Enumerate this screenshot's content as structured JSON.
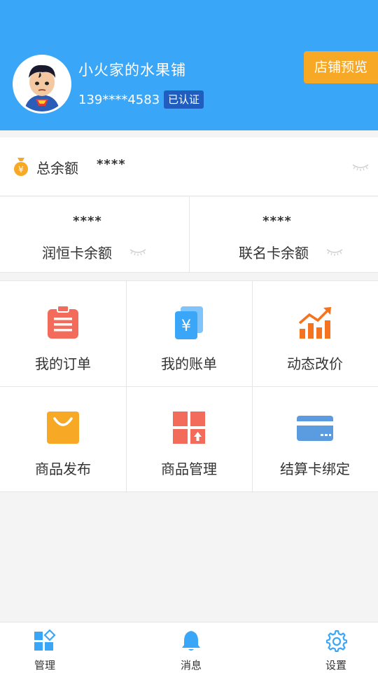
{
  "header": {
    "store_name": "小火家的水果铺",
    "phone": "139****4583",
    "verified_badge": "已认证",
    "preview_button": "店铺预览",
    "accent_color": "#3aa6f8",
    "preview_color": "#f7a825"
  },
  "balance": {
    "total_label": "总余额",
    "total_value": "****",
    "cards": [
      {
        "value": "****",
        "label": "润恒卡余额"
      },
      {
        "value": "****",
        "label": "联名卡余额"
      }
    ]
  },
  "menu": {
    "items": [
      {
        "label": "我的订单",
        "icon": "clipboard-icon",
        "color": "#f26b5b"
      },
      {
        "label": "我的账单",
        "icon": "bill-icon",
        "color": "#3aa6f8"
      },
      {
        "label": "动态改价",
        "icon": "chart-trend-icon",
        "color": "#f5731f"
      },
      {
        "label": "商品发布",
        "icon": "shopping-bag-icon",
        "color": "#f7a825"
      },
      {
        "label": "商品管理",
        "icon": "grid-manage-icon",
        "color": "#f26b5b"
      },
      {
        "label": "结算卡绑定",
        "icon": "bank-card-icon",
        "color": "#5b9be0"
      }
    ]
  },
  "bottom_nav": {
    "items": [
      {
        "label": "管理",
        "icon": "manage-icon"
      },
      {
        "label": "消息",
        "icon": "bell-icon"
      },
      {
        "label": "设置",
        "icon": "gear-icon"
      }
    ]
  }
}
